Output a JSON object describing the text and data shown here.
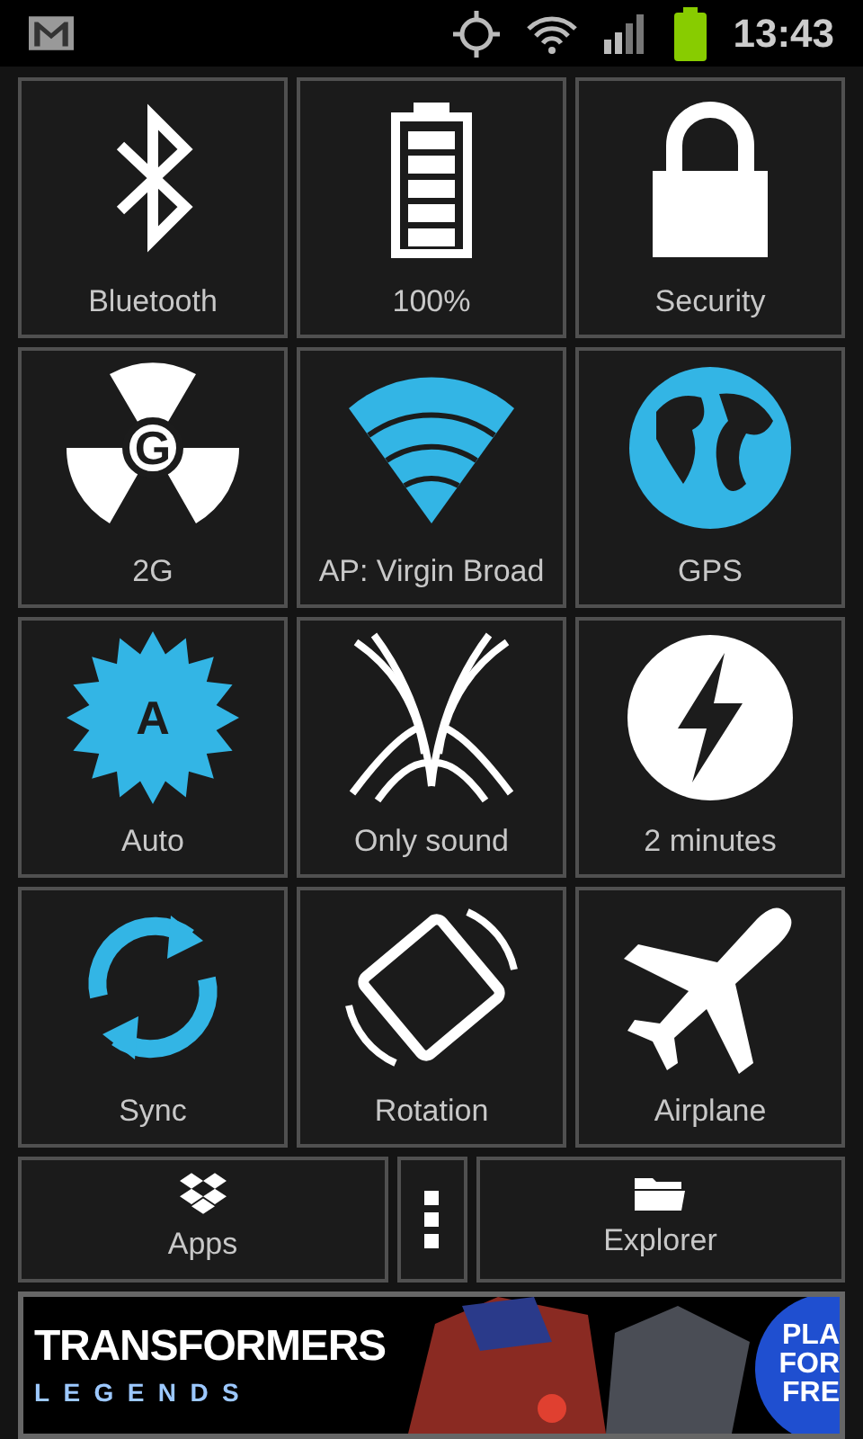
{
  "status_bar": {
    "time": "13:43"
  },
  "tiles": [
    {
      "label": "Bluetooth",
      "on": false
    },
    {
      "label": "100%",
      "on": false
    },
    {
      "label": "Security",
      "on": false
    },
    {
      "label": "2G",
      "on": false,
      "icon_text": "G"
    },
    {
      "label": "AP: Virgin Broad",
      "on": true
    },
    {
      "label": "GPS",
      "on": true
    },
    {
      "label": "Auto",
      "on": true,
      "icon_text": "A"
    },
    {
      "label": "Only sound",
      "on": false
    },
    {
      "label": "2 minutes",
      "on": false
    },
    {
      "label": "Sync",
      "on": true
    },
    {
      "label": "Rotation",
      "on": false
    },
    {
      "label": "Airplane",
      "on": false
    }
  ],
  "bottom_buttons": [
    {
      "label": "Apps"
    },
    {
      "label": "Explorer"
    }
  ],
  "ad": {
    "title": "TRANSFORMERS",
    "subtitle": "LEGENDS",
    "button_lines": [
      "PLA",
      "FOR",
      "FRE"
    ]
  }
}
